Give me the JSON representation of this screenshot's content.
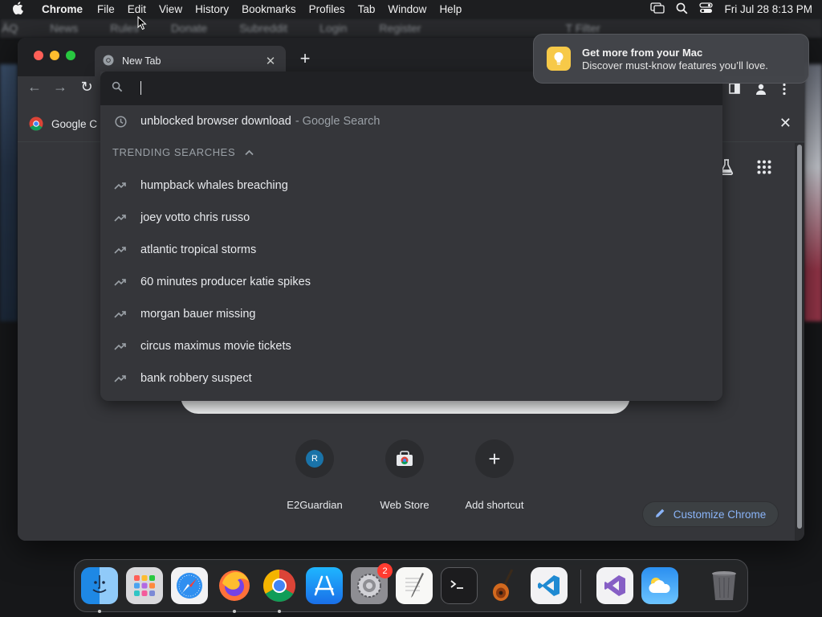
{
  "menubar": {
    "app_name": "Chrome",
    "items": [
      "File",
      "Edit",
      "View",
      "History",
      "Bookmarks",
      "Profiles",
      "Tab",
      "Window",
      "Help"
    ],
    "clock": "Fri Jul 28  8:13 PM"
  },
  "background": {
    "strip_items": [
      "ÄQ",
      "News",
      "Rules",
      "Donate",
      "Subreddit",
      "Login",
      "Register",
      "T Filter"
    ]
  },
  "window": {
    "tab": {
      "title": "New Tab"
    },
    "bookmarks_bar": {
      "item": "Google C"
    }
  },
  "omnibox": {
    "input_value": "",
    "history_item": {
      "text": "unblocked browser download",
      "suffix": "- Google Search"
    },
    "trending_heading": "TRENDING SEARCHES",
    "trending": [
      "humpback whales breaching",
      "joey votto chris russo",
      "atlantic tropical storms",
      "60 minutes producer katie spikes",
      "morgan bauer missing",
      "circus maximus movie tickets",
      "bank robbery suspect"
    ]
  },
  "ntp": {
    "shortcuts": [
      {
        "label": "E2Guardian",
        "letter": "R",
        "icon": "e2guardian-favicon"
      },
      {
        "label": "Web Store",
        "icon": "web-store-icon"
      },
      {
        "label": "Add shortcut",
        "icon": "plus-icon"
      }
    ],
    "customize_label": "Customize Chrome"
  },
  "notification": {
    "title": "Get more from your Mac",
    "body": "Discover must-know features you’ll love."
  },
  "dock": {
    "items": [
      "finder",
      "launchpad",
      "safari",
      "firefox",
      "chrome",
      "app-store",
      "system-settings",
      "textedit",
      "terminal",
      "garageband",
      "vscode",
      "visual-studio",
      "weather",
      "trash"
    ],
    "settings_badge": "2"
  },
  "colors": {
    "window_bg": "#35363a",
    "titlebar_bg": "#202124",
    "accent_link": "#8ab4f8",
    "notification_bulb": "#f7c948",
    "badge": "#ff3b30"
  }
}
